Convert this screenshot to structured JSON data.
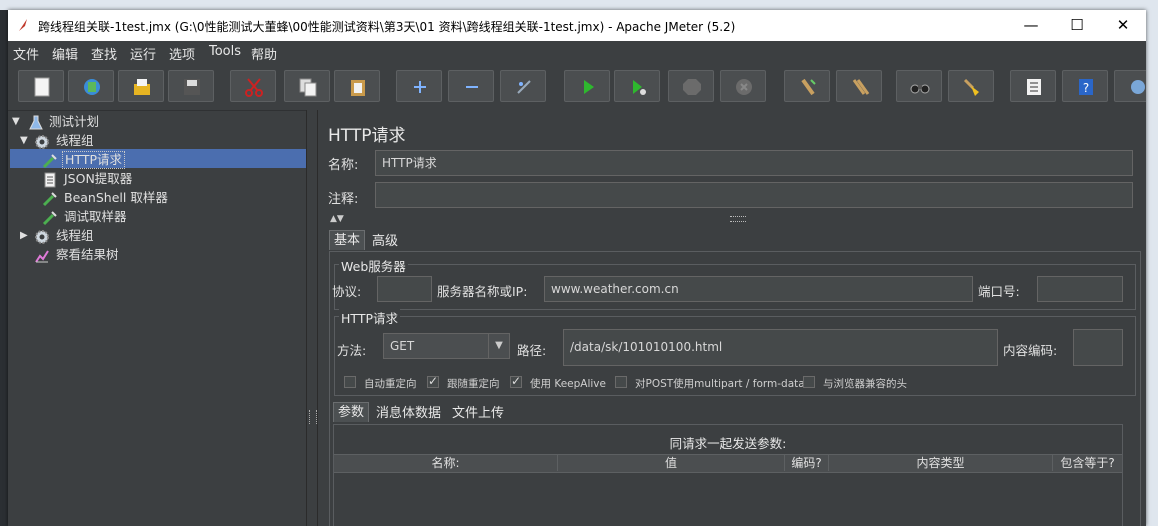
{
  "window": {
    "title": "跨线程组关联-1test.jmx (G:\\0性能测试大董蜂\\00性能测试资料\\第3天\\01 资料\\跨线程组关联-1test.jmx) - Apache JMeter (5.2)",
    "min_glyph": "—",
    "max_glyph": "☐",
    "close_glyph": "✕"
  },
  "menu": [
    "文件",
    "编辑",
    "查找",
    "运行",
    "选项",
    "Tools",
    "帮助"
  ],
  "toolbar": [
    "new-icon",
    "templates-icon",
    "open-icon",
    "save-icon",
    "cut-icon",
    "copy-icon",
    "paste-icon",
    "expand-icon",
    "collapse-icon",
    "toggle-icon",
    "start-icon",
    "start-no-pause-icon",
    "stop-icon",
    "shutdown-icon",
    "clear-icon",
    "clear-all-icon",
    "search-icon",
    "reset-search-icon",
    "function-helper-icon",
    "help-icon",
    "remote-icon"
  ],
  "tree": {
    "nodes": [
      {
        "label": "测试计划",
        "icon": "test-plan-icon"
      },
      {
        "label": "线程组",
        "icon": "thread-group-icon"
      },
      {
        "label": "HTTP请求",
        "icon": "sampler-icon"
      },
      {
        "label": "JSON提取器",
        "icon": "extractor-icon"
      },
      {
        "label": "BeanShell 取样器",
        "icon": "sampler-icon"
      },
      {
        "label": "调试取样器",
        "icon": "sampler-icon"
      },
      {
        "label": "线程组",
        "icon": "thread-group-icon"
      },
      {
        "label": "察看结果树",
        "icon": "listener-icon"
      }
    ]
  },
  "form": {
    "panel_title": "HTTP请求",
    "name_label": "名称:",
    "name_value": "HTTP请求",
    "comment_label": "注释:",
    "comment_value": "",
    "tabs": [
      "基本",
      "高级"
    ],
    "web_server": {
      "title": "Web服务器",
      "protocol_label": "协议:",
      "protocol_value": "",
      "server_label": "服务器名称或IP:",
      "server_value": "www.weather.com.cn",
      "port_label": "端口号:",
      "port_value": ""
    },
    "http_request": {
      "title": "HTTP请求",
      "method_label": "方法:",
      "method_value": "GET",
      "path_label": "路径:",
      "path_value": "/data/sk/101010100.html",
      "encoding_label": "内容编码:",
      "encoding_value": ""
    },
    "options": [
      {
        "label": "自动重定向",
        "checked": false
      },
      {
        "label": "跟随重定向",
        "checked": true
      },
      {
        "label": "使用 KeepAlive",
        "checked": true
      },
      {
        "label": "对POST使用multipart / form-data",
        "checked": false
      },
      {
        "label": "与浏览器兼容的头",
        "checked": false
      }
    ],
    "subtabs": [
      "参数",
      "消息体数据",
      "文件上传"
    ],
    "params_caption": "同请求一起发送参数:",
    "columns": [
      "名称:",
      "值",
      "编码?",
      "内容类型",
      "包含等于?"
    ]
  }
}
